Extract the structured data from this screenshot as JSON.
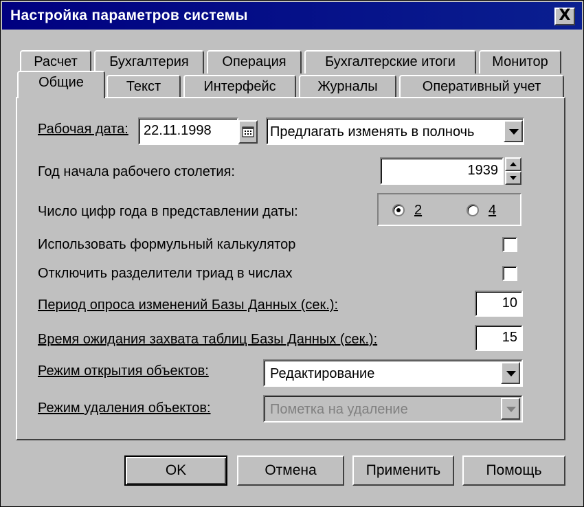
{
  "window": {
    "title": "Настройка параметров системы",
    "close_glyph": "X"
  },
  "tabs_row_back": [
    "Расчет",
    "Бухгалтерия",
    "Операция",
    "Бухгалтерские итоги",
    "Монитор"
  ],
  "tabs_row_front": [
    "Общие",
    "Текст",
    "Интерфейс",
    "Журналы",
    "Оперативный учет"
  ],
  "active_tab": "Общие",
  "fields": {
    "work_date": {
      "label": "Рабочая дата:",
      "value": "22.11.1998",
      "mode": "Предлагать изменять в полночь"
    },
    "century_year": {
      "label": "Год начала рабочего столетия:",
      "value": "1939"
    },
    "year_digits": {
      "label": "Число цифр года в представлении даты:",
      "options": [
        "2",
        "4"
      ],
      "selected": "2"
    },
    "formula_calc": {
      "label": "Использовать формульный калькулятор",
      "checked": false
    },
    "triad_sep": {
      "label": "Отключить разделители триад в числах",
      "checked": false
    },
    "poll_period": {
      "label": "Период опроса изменений Базы Данных (сек.):",
      "value": "10"
    },
    "lock_timeout": {
      "label": "Время ожидания захвата таблиц Базы Данных (сек.):",
      "value": "15"
    },
    "open_mode": {
      "label": "Режим открытия объектов:",
      "value": "Редактирование"
    },
    "delete_mode": {
      "label": "Режим удаления объектов:",
      "value": "Пометка на удаление"
    }
  },
  "buttons": {
    "ok": "OK",
    "cancel": "Отмена",
    "apply": "Применить",
    "help": "Помощь"
  }
}
